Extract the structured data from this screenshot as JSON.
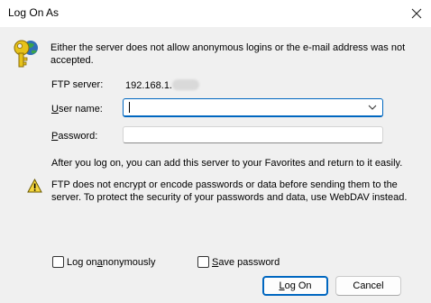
{
  "window": {
    "title": "Log On As",
    "close_glyph": "✕"
  },
  "intro_text": "Either the server does not allow anonymous logins or the e-mail address was not accepted.",
  "ftp_server": {
    "label": "FTP server:",
    "value": "192.168.1."
  },
  "user": {
    "label_first": "U",
    "label_rest": "ser name:",
    "value": ""
  },
  "password": {
    "label_first": "P",
    "label_rest": "assword:",
    "value": ""
  },
  "after_logon_text": "After you log on, you can add this server to your Favorites and return to it easily.",
  "warning_text": "FTP does not encrypt or encode passwords or data before sending them to the server.  To protect the security of your passwords and data, use WebDAV instead.",
  "checkboxes": {
    "anonymous": {
      "pre": "Log on ",
      "accel": "a",
      "post": "nonymously",
      "checked": false
    },
    "save_password": {
      "pre": "",
      "accel": "S",
      "post": "ave password",
      "checked": false
    }
  },
  "buttons": {
    "logon": {
      "accel": "L",
      "rest": "og On"
    },
    "cancel": "Cancel"
  },
  "icons": {
    "key": "key-icon",
    "warning": "warning-icon",
    "close": "close-icon",
    "dropdown": "chevron-down-icon"
  },
  "colors": {
    "accent": "#0067c0",
    "dialog_bg": "#f0f0f0",
    "key_gold": "#e6c21a",
    "warning_yellow": "#f5d63d"
  }
}
